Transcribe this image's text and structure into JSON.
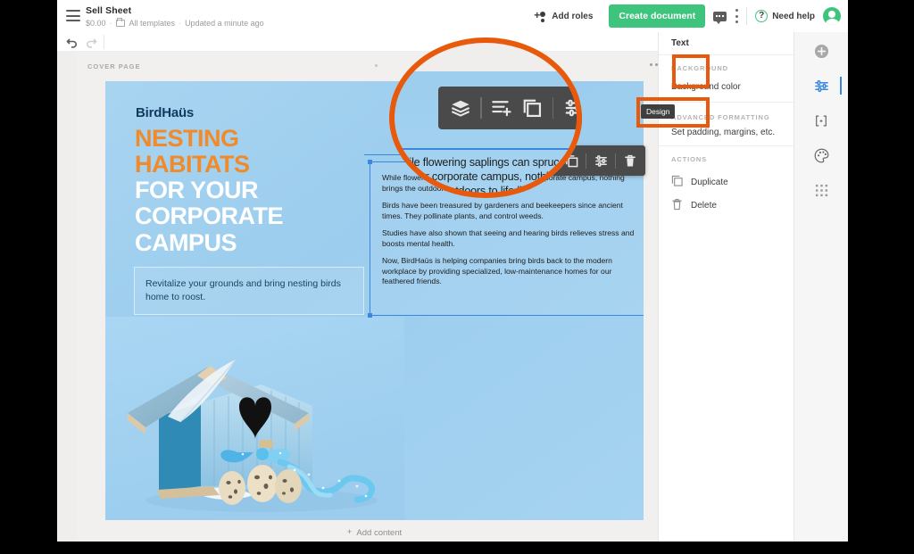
{
  "window": {
    "title": "Sell Sheet",
    "meta_price": "$0.00",
    "meta_folder": "All templates",
    "meta_updated": "Updated a minute ago",
    "sep": "·"
  },
  "topbar": {
    "add_roles_label": "Add roles",
    "create_document_label": "Create document",
    "need_help_label": "Need help",
    "help_glyph": "?",
    "icons": {
      "hamburger": "hamburger-icon",
      "add_person": "add-person-icon",
      "comment": "comment-icon",
      "kebab": "kebab-menu-icon",
      "avatar": "user-avatar"
    }
  },
  "toolbar2": {
    "undo": "undo-icon",
    "redo": "redo-icon"
  },
  "editor": {
    "page_label": "COVER PAGE",
    "add_content_label": "Add content",
    "add_content_plus": "+"
  },
  "document": {
    "brand": "BirdHaüs",
    "headline_orange": [
      "NESTING",
      "HABITATS"
    ],
    "headline_white": [
      "FOR YOUR",
      "CORPORATE",
      "CAMPUS"
    ],
    "subhead": "Revitalize your grounds and bring nesting birds home to roost.",
    "body_paragraphs": [
      "While flowering saplings can spruce up your corporate campus, nothing brings the outdoors to life like birdsong.",
      "Birds have been treasured by gardeners and beekeepers since ancient times. They pollinate plants, and control weeds.",
      "Studies have also shown that seeing and hearing birds relieves stress and boosts mental health.",
      "Now, BirdHaüs is helping companies bring birds back to the modern workplace by providing specialized, low-maintenance homes for our feathered friends."
    ]
  },
  "float_toolbar": {
    "items": [
      {
        "name": "layers-icon",
        "label": "Layers"
      },
      {
        "name": "add-row-icon",
        "label": "Add row"
      },
      {
        "name": "duplicate-icon",
        "label": "Duplicate"
      },
      {
        "name": "settings-sliders-icon",
        "label": "Settings"
      },
      {
        "name": "trash-icon",
        "label": "Delete"
      }
    ]
  },
  "rail": {
    "items": [
      {
        "name": "add-icon",
        "label": "Add"
      },
      {
        "name": "settings-sliders-icon",
        "label": "Settings"
      },
      {
        "name": "variables-icon",
        "label": "Variables"
      },
      {
        "name": "palette-icon",
        "label": "Design"
      },
      {
        "name": "grid-icon",
        "label": "Grid"
      }
    ]
  },
  "panel": {
    "title": "Text",
    "close_glyph": "✕",
    "background_section": "BACKGROUND",
    "background_color_label": "Background color",
    "advanced_section": "ADVANCED FORMATTING",
    "advanced_chevron": "›",
    "advanced_sub": "Set padding, margins, etc.",
    "actions_section": "ACTIONS",
    "duplicate_label": "Duplicate",
    "delete_label": "Delete"
  },
  "annotations": {
    "tooltip_label": "Design",
    "highlight_color": "#e8590c"
  },
  "colors": {
    "accent_green": "#3fc47d",
    "selection_blue": "#3a87e0",
    "headline_orange": "#f08a2a",
    "page_blue": "#9ccdee",
    "brand_navy": "#12395e"
  }
}
